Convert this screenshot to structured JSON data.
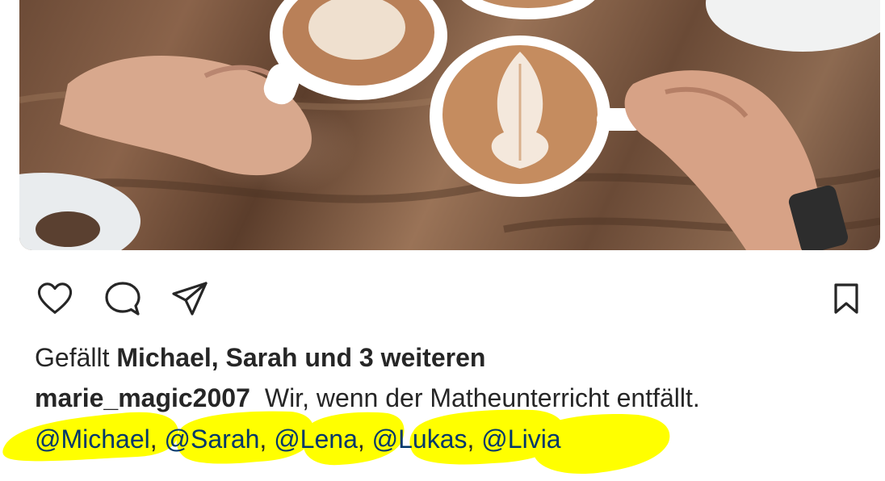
{
  "post": {
    "image_alt": "",
    "actions": {
      "like_icon": "heart-icon",
      "comment_icon": "comment-bubble-icon",
      "share_icon": "paper-plane-icon",
      "save_icon": "bookmark-icon"
    },
    "likes": {
      "prefix": "Gefällt",
      "bold_text": "Michael, Sarah und 3 weiteren"
    },
    "caption": {
      "username": "marie_magic2007",
      "text": "Wir, wenn der Matheunterricht entfällt."
    },
    "tags": [
      "@Michael",
      "@Sarah",
      "@Lena",
      "@Lukas",
      "@Livia"
    ],
    "tag_separator": ", ",
    "colors": {
      "text": "#262626",
      "tag": "#00376b",
      "highlighter": "#ffff00"
    }
  }
}
